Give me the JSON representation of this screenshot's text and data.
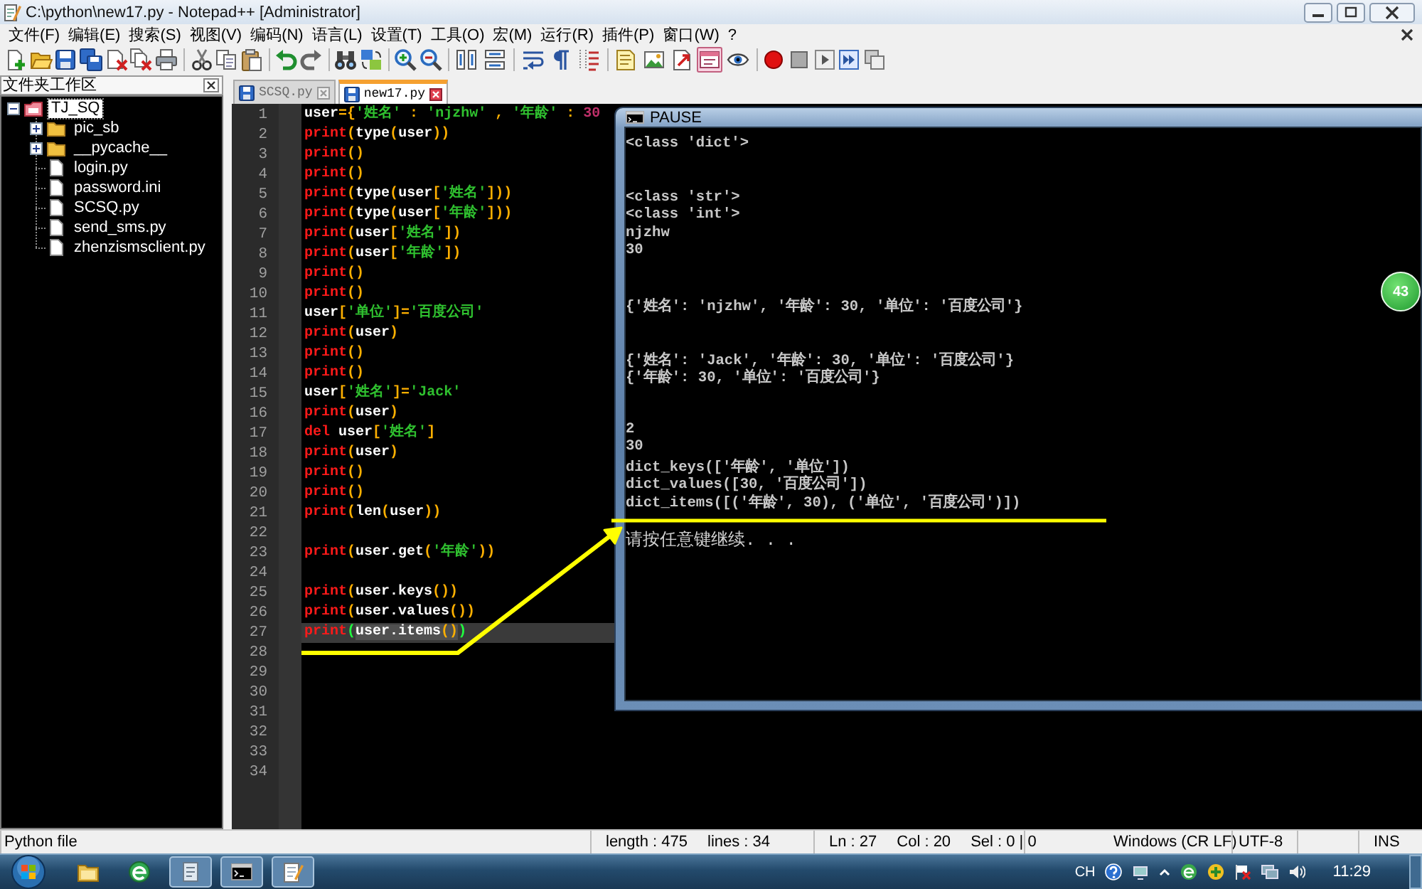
{
  "window": {
    "title": "C:\\python\\new17.py - Notepad++ [Administrator]"
  },
  "menu": [
    "文件(F)",
    "编辑(E)",
    "搜索(S)",
    "视图(V)",
    "编码(N)",
    "语言(L)",
    "设置(T)",
    "工具(O)",
    "宏(M)",
    "运行(R)",
    "插件(P)",
    "窗口(W)",
    "?"
  ],
  "toolbar": {
    "toggles": [
      {
        "pressed": false
      },
      {
        "pressed": false
      },
      {
        "pressed": false
      },
      {
        "pressed": false
      },
      {
        "pressed": false
      },
      {
        "pressed": false
      },
      {
        "pressed": false
      },
      {
        "pressed": false
      },
      {
        "pressed": true
      },
      {
        "pressed": false
      }
    ]
  },
  "folder_panel": {
    "title": "文件夹工作区",
    "tree": [
      {
        "label": "TJ_SQ",
        "kind": "project",
        "expanded": true,
        "selected": true,
        "children": [
          {
            "label": "pic_sb",
            "kind": "folder",
            "expanded": false,
            "selected": false
          },
          {
            "label": "__pycache__",
            "kind": "folder",
            "expanded": false,
            "selected": false
          },
          {
            "label": "login.py",
            "kind": "file",
            "selected": false
          },
          {
            "label": "password.ini",
            "kind": "file",
            "selected": false
          },
          {
            "label": "SCSQ.py",
            "kind": "file",
            "selected": false
          },
          {
            "label": "send_sms.py",
            "kind": "file",
            "selected": false
          },
          {
            "label": "zhenzismsclient.py",
            "kind": "file",
            "selected": false
          }
        ]
      }
    ]
  },
  "tabs": [
    {
      "label": "SCSQ.py",
      "selected": false
    },
    {
      "label": "new17.py",
      "selected": true
    }
  ],
  "editor": {
    "lines": [
      {
        "number": "1",
        "current": false,
        "tokens": [
          {
            "kind": "name",
            "text": "user"
          },
          {
            "kind": "punct",
            "text": "={"
          },
          {
            "kind": "string",
            "text": "'姓名'"
          },
          {
            "kind": "punct",
            "text": " : "
          },
          {
            "kind": "string",
            "text": "'njzhw'"
          },
          {
            "kind": "punct",
            "text": " , "
          },
          {
            "kind": "string",
            "text": "'年龄'"
          },
          {
            "kind": "punct",
            "text": " : "
          },
          {
            "kind": "number",
            "text": "30"
          }
        ]
      },
      {
        "number": "2",
        "current": false,
        "tokens": [
          {
            "kind": "keyword",
            "text": "print"
          },
          {
            "kind": "punct",
            "text": "("
          },
          {
            "kind": "name",
            "text": "type"
          },
          {
            "kind": "punct",
            "text": "("
          },
          {
            "kind": "name",
            "text": "user"
          },
          {
            "kind": "punct",
            "text": "))"
          }
        ]
      },
      {
        "number": "3",
        "current": false,
        "tokens": [
          {
            "kind": "keyword",
            "text": "print"
          },
          {
            "kind": "punct",
            "text": "()"
          }
        ]
      },
      {
        "number": "4",
        "current": false,
        "tokens": [
          {
            "kind": "keyword",
            "text": "print"
          },
          {
            "kind": "punct",
            "text": "()"
          }
        ]
      },
      {
        "number": "5",
        "current": false,
        "tokens": [
          {
            "kind": "keyword",
            "text": "print"
          },
          {
            "kind": "punct",
            "text": "("
          },
          {
            "kind": "name",
            "text": "type"
          },
          {
            "kind": "punct",
            "text": "("
          },
          {
            "kind": "name",
            "text": "user"
          },
          {
            "kind": "punct",
            "text": "["
          },
          {
            "kind": "string",
            "text": "'姓名'"
          },
          {
            "kind": "punct",
            "text": "]))"
          }
        ]
      },
      {
        "number": "6",
        "current": false,
        "tokens": [
          {
            "kind": "keyword",
            "text": "print"
          },
          {
            "kind": "punct",
            "text": "("
          },
          {
            "kind": "name",
            "text": "type"
          },
          {
            "kind": "punct",
            "text": "("
          },
          {
            "kind": "name",
            "text": "user"
          },
          {
            "kind": "punct",
            "text": "["
          },
          {
            "kind": "string",
            "text": "'年龄'"
          },
          {
            "kind": "punct",
            "text": "]))"
          }
        ]
      },
      {
        "number": "7",
        "current": false,
        "tokens": [
          {
            "kind": "keyword",
            "text": "print"
          },
          {
            "kind": "punct",
            "text": "("
          },
          {
            "kind": "name",
            "text": "user"
          },
          {
            "kind": "punct",
            "text": "["
          },
          {
            "kind": "string",
            "text": "'姓名'"
          },
          {
            "kind": "punct",
            "text": "])"
          }
        ]
      },
      {
        "number": "8",
        "current": false,
        "tokens": [
          {
            "kind": "keyword",
            "text": "print"
          },
          {
            "kind": "punct",
            "text": "("
          },
          {
            "kind": "name",
            "text": "user"
          },
          {
            "kind": "punct",
            "text": "["
          },
          {
            "kind": "string",
            "text": "'年龄'"
          },
          {
            "kind": "punct",
            "text": "])"
          }
        ]
      },
      {
        "number": "9",
        "current": false,
        "tokens": [
          {
            "kind": "keyword",
            "text": "print"
          },
          {
            "kind": "punct",
            "text": "()"
          }
        ]
      },
      {
        "number": "10",
        "current": false,
        "tokens": [
          {
            "kind": "keyword",
            "text": "print"
          },
          {
            "kind": "punct",
            "text": "()"
          }
        ]
      },
      {
        "number": "11",
        "current": false,
        "tokens": [
          {
            "kind": "name",
            "text": "user"
          },
          {
            "kind": "punct",
            "text": "["
          },
          {
            "kind": "string",
            "text": "'单位'"
          },
          {
            "kind": "punct",
            "text": "]="
          },
          {
            "kind": "string",
            "text": "'百度公司'"
          }
        ]
      },
      {
        "number": "12",
        "current": false,
        "tokens": [
          {
            "kind": "keyword",
            "text": "print"
          },
          {
            "kind": "punct",
            "text": "("
          },
          {
            "kind": "name",
            "text": "user"
          },
          {
            "kind": "punct",
            "text": ")"
          }
        ]
      },
      {
        "number": "13",
        "current": false,
        "tokens": [
          {
            "kind": "keyword",
            "text": "print"
          },
          {
            "kind": "punct",
            "text": "()"
          }
        ]
      },
      {
        "number": "14",
        "current": false,
        "tokens": [
          {
            "kind": "keyword",
            "text": "print"
          },
          {
            "kind": "punct",
            "text": "()"
          }
        ]
      },
      {
        "number": "15",
        "current": false,
        "tokens": [
          {
            "kind": "name",
            "text": "user"
          },
          {
            "kind": "punct",
            "text": "["
          },
          {
            "kind": "string",
            "text": "'姓名'"
          },
          {
            "kind": "punct",
            "text": "]="
          },
          {
            "kind": "string",
            "text": "'Jack'"
          }
        ]
      },
      {
        "number": "16",
        "current": false,
        "tokens": [
          {
            "kind": "keyword",
            "text": "print"
          },
          {
            "kind": "punct",
            "text": "("
          },
          {
            "kind": "name",
            "text": "user"
          },
          {
            "kind": "punct",
            "text": ")"
          }
        ]
      },
      {
        "number": "17",
        "current": false,
        "tokens": [
          {
            "kind": "keyword",
            "text": "del"
          },
          {
            "kind": "name",
            "text": " user"
          },
          {
            "kind": "punct",
            "text": "["
          },
          {
            "kind": "string",
            "text": "'姓名'"
          },
          {
            "kind": "punct",
            "text": "]"
          }
        ]
      },
      {
        "number": "18",
        "current": false,
        "tokens": [
          {
            "kind": "keyword",
            "text": "print"
          },
          {
            "kind": "punct",
            "text": "("
          },
          {
            "kind": "name",
            "text": "user"
          },
          {
            "kind": "punct",
            "text": ")"
          }
        ]
      },
      {
        "number": "19",
        "current": false,
        "tokens": [
          {
            "kind": "keyword",
            "text": "print"
          },
          {
            "kind": "punct",
            "text": "()"
          }
        ]
      },
      {
        "number": "20",
        "current": false,
        "tokens": [
          {
            "kind": "keyword",
            "text": "print"
          },
          {
            "kind": "punct",
            "text": "()"
          }
        ]
      },
      {
        "number": "21",
        "current": false,
        "tokens": [
          {
            "kind": "keyword",
            "text": "print"
          },
          {
            "kind": "punct",
            "text": "("
          },
          {
            "kind": "name",
            "text": "len"
          },
          {
            "kind": "punct",
            "text": "("
          },
          {
            "kind": "name",
            "text": "user"
          },
          {
            "kind": "punct",
            "text": "))"
          }
        ]
      },
      {
        "number": "22",
        "current": false
      },
      {
        "number": "23",
        "current": false,
        "tokens": [
          {
            "kind": "keyword",
            "text": "print"
          },
          {
            "kind": "punct",
            "text": "("
          },
          {
            "kind": "name",
            "text": "user.get"
          },
          {
            "kind": "punct",
            "text": "("
          },
          {
            "kind": "string",
            "text": "'年龄'"
          },
          {
            "kind": "punct",
            "text": "))"
          }
        ]
      },
      {
        "number": "24",
        "current": false
      },
      {
        "number": "25",
        "current": false,
        "tokens": [
          {
            "kind": "keyword",
            "text": "print"
          },
          {
            "kind": "punct",
            "text": "("
          },
          {
            "kind": "name",
            "text": "user.keys"
          },
          {
            "kind": "punct",
            "text": "())"
          }
        ]
      },
      {
        "number": "26",
        "current": false,
        "tokens": [
          {
            "kind": "keyword",
            "text": "print"
          },
          {
            "kind": "punct",
            "text": "("
          },
          {
            "kind": "name",
            "text": "user.values"
          },
          {
            "kind": "punct",
            "text": "())"
          }
        ]
      },
      {
        "number": "27",
        "current": true,
        "tokens": [
          {
            "kind": "keyword",
            "text": "print"
          },
          {
            "kind": "brace",
            "text": "("
          },
          {
            "kind": "marked",
            "text": "user.items"
          },
          {
            "kind": "markedpunct",
            "text": "()"
          },
          {
            "kind": "brace",
            "text": ")"
          }
        ]
      },
      {
        "number": "28",
        "current": false
      },
      {
        "number": "29",
        "current": false
      },
      {
        "number": "30",
        "current": false
      },
      {
        "number": "31",
        "current": false
      },
      {
        "number": "32",
        "current": false
      },
      {
        "number": "33",
        "current": false
      },
      {
        "number": "34",
        "current": false
      }
    ]
  },
  "console": {
    "title": "PAUSE",
    "lines": [
      {
        "kind": "output",
        "text": "<class 'dict'>"
      },
      {
        "kind": "blank"
      },
      {
        "kind": "blank"
      },
      {
        "kind": "output",
        "text": "<class 'str'>"
      },
      {
        "kind": "output",
        "text": "<class 'int'>"
      },
      {
        "kind": "output",
        "text": "njzhw"
      },
      {
        "kind": "output",
        "text": "30"
      },
      {
        "kind": "blank"
      },
      {
        "kind": "blank"
      },
      {
        "kind": "output",
        "text": "{'姓名': 'njzhw', '年龄': 30, '单位': '百度公司'}"
      },
      {
        "kind": "blank"
      },
      {
        "kind": "blank"
      },
      {
        "kind": "output",
        "text": "{'姓名': 'Jack', '年龄': 30, '单位': '百度公司'}"
      },
      {
        "kind": "output",
        "text": "{'年龄': 30, '单位': '百度公司'}"
      },
      {
        "kind": "blank"
      },
      {
        "kind": "blank"
      },
      {
        "kind": "output",
        "text": "2"
      },
      {
        "kind": "output",
        "text": "30"
      },
      {
        "kind": "output",
        "text": "dict_keys(['年龄', '单位'])"
      },
      {
        "kind": "output",
        "text": "dict_values([30, '百度公司'])"
      },
      {
        "kind": "output",
        "text": "dict_items([('年龄', 30), ('单位', '百度公司')])"
      },
      {
        "kind": "blank"
      },
      {
        "kind": "prompt",
        "text": "请按任意键继续. . ."
      }
    ]
  },
  "floating_badge": {
    "text": "43"
  },
  "status_bar": {
    "file_type": "Python file",
    "length": "length : 475",
    "lines": "lines : 34",
    "position": "Ln : 27",
    "column": "Col : 20",
    "selection": "Sel : 0 | 0",
    "line_ending": "Windows (CR LF)",
    "encoding": "UTF-8",
    "mode": "INS"
  },
  "taskbar": {
    "buttons": [
      {
        "running": false
      },
      {
        "running": false
      },
      {
        "running": true
      },
      {
        "running": true
      },
      {
        "running": true
      }
    ],
    "language": "CH",
    "time": "11:29"
  }
}
